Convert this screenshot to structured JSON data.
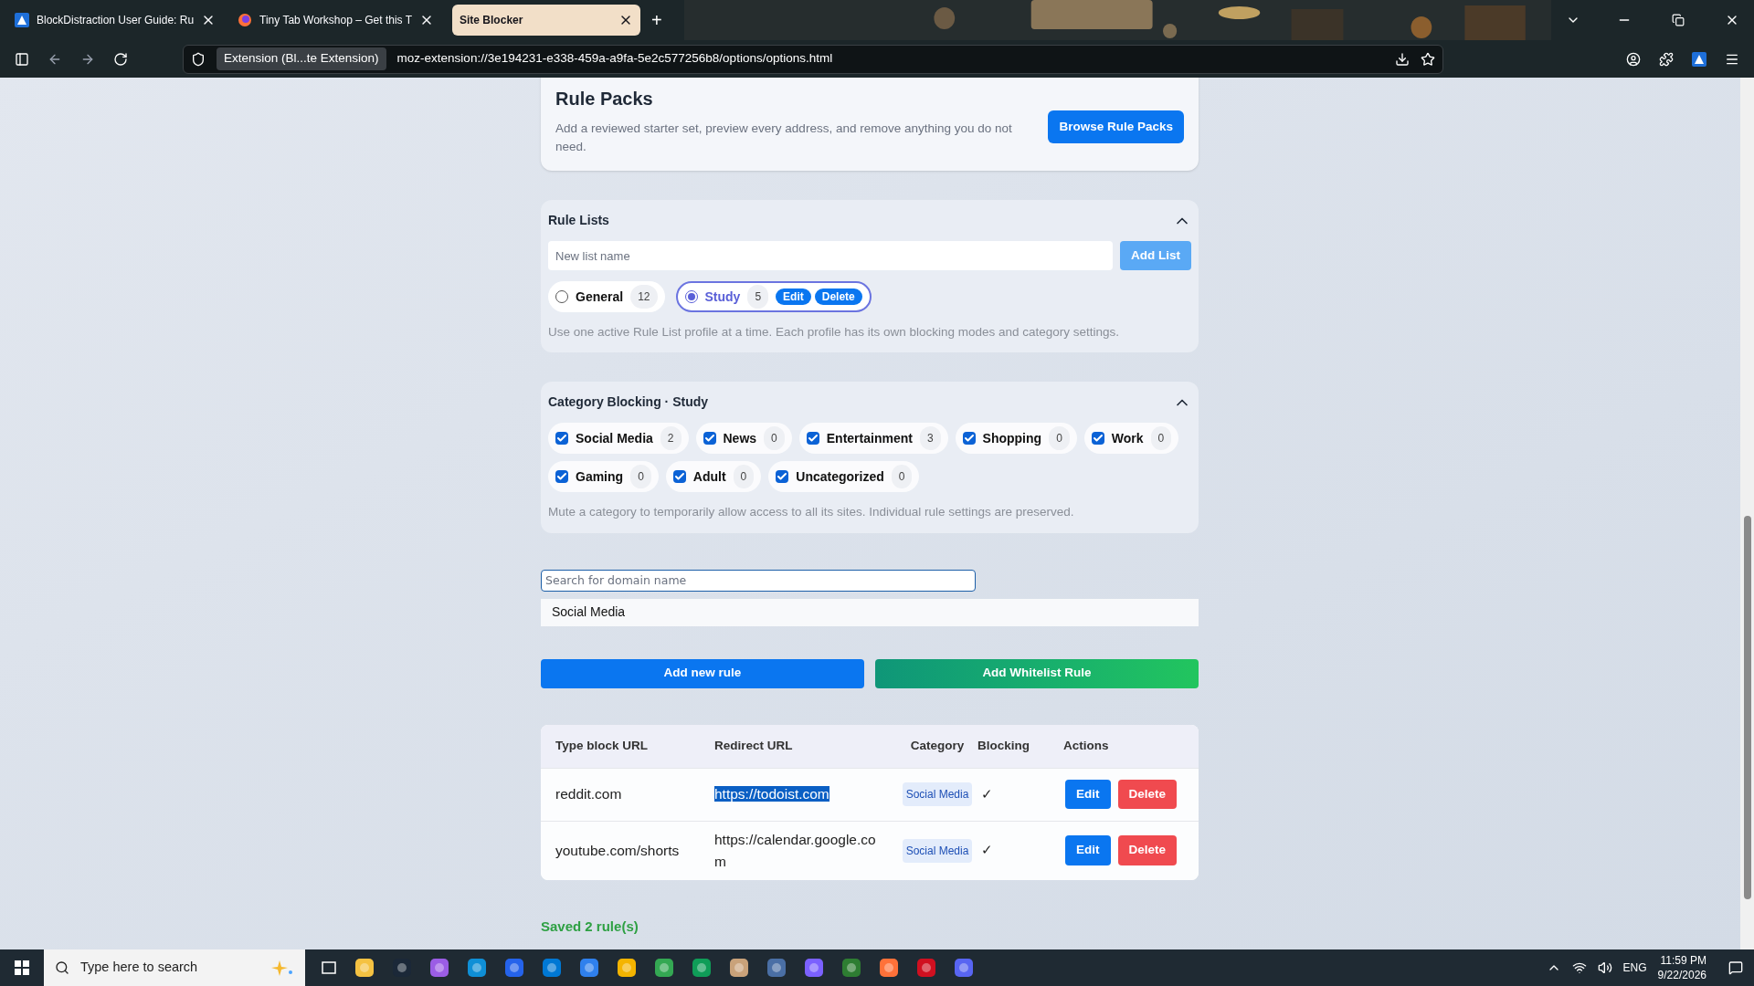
{
  "browser": {
    "tabs": [
      {
        "title": "BlockDistraction User Guide: Ru",
        "selected": false,
        "kind": "triangle"
      },
      {
        "title": "Tiny Tab Workshop – Get this T",
        "selected": false,
        "kind": "fox"
      },
      {
        "title": "Site Blocker",
        "selected": true,
        "kind": "none"
      }
    ],
    "new_tab": "+",
    "identity": "Extension (Bl...te Extension)",
    "url": "moz-extension://3e194231-e338-459a-a9fa-5e2c577256b8/options/options.html"
  },
  "rule_packs": {
    "title": "Rule Packs",
    "description": "Add a reviewed starter set, preview every address, and remove anything you do not need.",
    "button": "Browse Rule Packs"
  },
  "rule_lists": {
    "title": "Rule Lists",
    "expanded": true,
    "input": {
      "placeholder": "New list name"
    },
    "add_button": "Add List",
    "lists": [
      {
        "name": "General",
        "count": "12",
        "selected": false
      },
      {
        "name": "Study",
        "count": "5",
        "selected": true,
        "edit": "Edit",
        "delete": "Delete"
      }
    ],
    "hint": "Use one active Rule List profile at a time. Each profile has its own blocking modes and category settings."
  },
  "category_blocking": {
    "title": "Category Blocking · Study",
    "expanded": true,
    "categories": [
      {
        "name": "Social Media",
        "count": "2",
        "checked": true
      },
      {
        "name": "News",
        "count": "0",
        "checked": true
      },
      {
        "name": "Entertainment",
        "count": "3",
        "checked": true
      },
      {
        "name": "Shopping",
        "count": "0",
        "checked": true
      },
      {
        "name": "Work",
        "count": "0",
        "checked": true
      },
      {
        "name": "Gaming",
        "count": "0",
        "checked": true
      },
      {
        "name": "Adult",
        "count": "0",
        "checked": true
      },
      {
        "name": "Uncategorized",
        "count": "0",
        "checked": true
      }
    ],
    "hint": "Mute a category to temporarily allow access to all its sites. Individual rule settings are preserved."
  },
  "search": {
    "placeholder": "Search for domain name"
  },
  "group_header": "Social Media",
  "actions": {
    "add_rule": "Add new rule",
    "add_whitelist": "Add Whitelist Rule"
  },
  "table": {
    "columns": [
      "Type block URL",
      "Redirect URL",
      "Category",
      "Blocking",
      "Actions"
    ],
    "rows": [
      {
        "url": "reddit.com",
        "redirect": "https://todoist.com",
        "redirect_highlighted": true,
        "category": "Social Media",
        "blocking": "✓",
        "edit": "Edit",
        "delete": "Delete"
      },
      {
        "url": "youtube.com/shorts",
        "redirect": "https://calendar.google.com",
        "redirect_highlighted": false,
        "category": "Social Media",
        "blocking": "✓",
        "edit": "Edit",
        "delete": "Delete"
      }
    ]
  },
  "status": "Saved 2 rule(s)",
  "taskbar": {
    "search_placeholder": "Type here to search",
    "language": "ENG",
    "time": "11:59 PM",
    "date": "9/22/2026"
  }
}
